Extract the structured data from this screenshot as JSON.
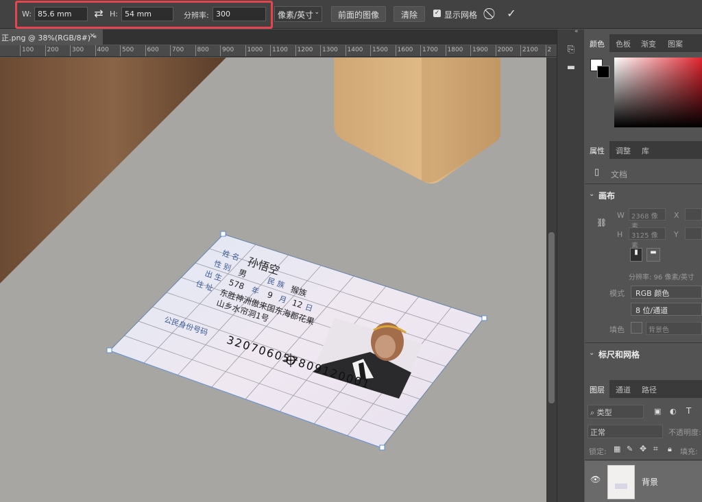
{
  "options_bar": {
    "w_label": "W:",
    "w_value": "85.6 mm",
    "h_label": "H:",
    "h_value": "54 mm",
    "res_label": "分辨率:",
    "res_value": "300",
    "unit_select": "像素/英寸",
    "front_image_button": "前面的图像",
    "clear_button": "清除",
    "show_grid_label": "显示网格"
  },
  "tab": {
    "title": "正.png @ 38%(RGB/8#) *",
    "close": "×"
  },
  "ruler": {
    "ticks": [
      "100",
      "200",
      "300",
      "400",
      "500",
      "600",
      "700",
      "800",
      "900",
      "1000",
      "1100",
      "1200",
      "1300",
      "1400",
      "1500",
      "1600",
      "1700",
      "1800",
      "1900",
      "2000",
      "2100",
      "2"
    ]
  },
  "id_card": {
    "name_label": "姓 名",
    "name_value": "孙悟空",
    "sex_label": "性 别",
    "sex_value": "男",
    "ethnic_label": "民 族",
    "ethnic_value": "猴族",
    "birth_label": "出 生",
    "birth_year": "578",
    "year_char": "年",
    "birth_month": "9",
    "month_char": "月",
    "birth_day": "12",
    "day_char": "日",
    "address_label": "住 址",
    "address_line1": "东胜神洲傲来国东海郡花果",
    "address_line2": "山乡水帘洞1号",
    "id_label": "公民身份号码",
    "id_number": "320706057809120001"
  },
  "color_panel": {
    "tabs": [
      "颜色",
      "色板",
      "渐变",
      "图案"
    ]
  },
  "properties_panel": {
    "tabs": [
      "属性",
      "调整",
      "库"
    ],
    "doc_label": "文档",
    "canvas_title": "画布",
    "w_label": "W",
    "w_value": "2368 像素",
    "x_label": "X",
    "h_label": "H",
    "h_value": "3125 像素",
    "y_label": "Y",
    "resolution": "分辨率: 96 像素/英寸",
    "mode_label": "模式",
    "mode_value": "RGB 颜色",
    "depth_value": "8 位/通道",
    "fill_label": "填色",
    "fill_value": "背景色",
    "rulers_title": "标尺和网格"
  },
  "layers_panel": {
    "tabs": [
      "图层",
      "通道",
      "路径"
    ],
    "filter_label": "类型",
    "blend_mode": "正常",
    "opacity_label": "不透明度:",
    "lock_label": "锁定:",
    "fill_label": "填充:",
    "layer_name": "背景"
  },
  "colors": {
    "highlight": "#e5454f",
    "transform_handle": "#5b8fd6"
  }
}
